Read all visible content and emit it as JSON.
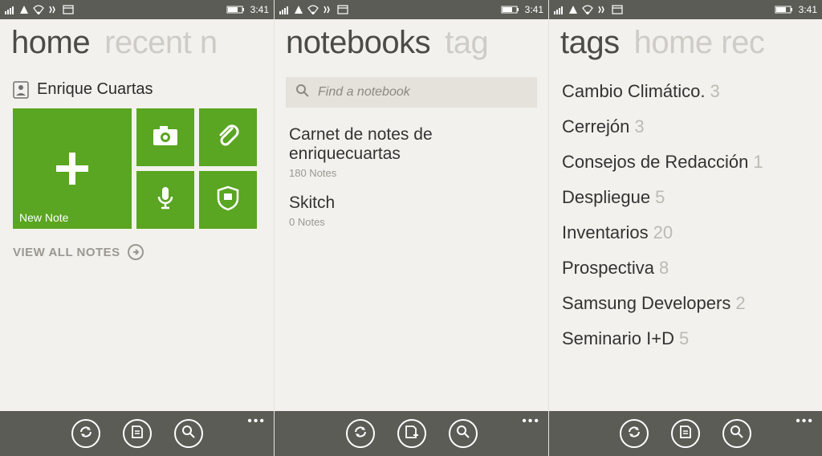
{
  "status": {
    "time": "3:41"
  },
  "panel1": {
    "pivot_active": "home",
    "pivot_rest": "recent n",
    "user_name": "Enrique Cuartas",
    "new_note_label": "New Note",
    "view_all_label": "VIEW ALL NOTES"
  },
  "panel2": {
    "pivot_active": "notebooks",
    "pivot_rest": "tag",
    "search_placeholder": "Find a notebook",
    "notebooks": [
      {
        "title": "Carnet de notes de enriquecuartas",
        "sub": "180 Notes"
      },
      {
        "title": "Skitch",
        "sub": "0 Notes"
      }
    ]
  },
  "panel3": {
    "pivot_active": "tags",
    "pivot_rest": "home rec",
    "tags": [
      {
        "name": "Cambio Climático.",
        "count": "3"
      },
      {
        "name": "Cerrejón",
        "count": "3"
      },
      {
        "name": "Consejos de Redacción",
        "count": "1"
      },
      {
        "name": "Despliegue",
        "count": "5"
      },
      {
        "name": "Inventarios",
        "count": "20"
      },
      {
        "name": "Prospectiva",
        "count": "8"
      },
      {
        "name": "Samsung Developers",
        "count": "2"
      },
      {
        "name": "Seminario I+D",
        "count": "5"
      }
    ]
  }
}
